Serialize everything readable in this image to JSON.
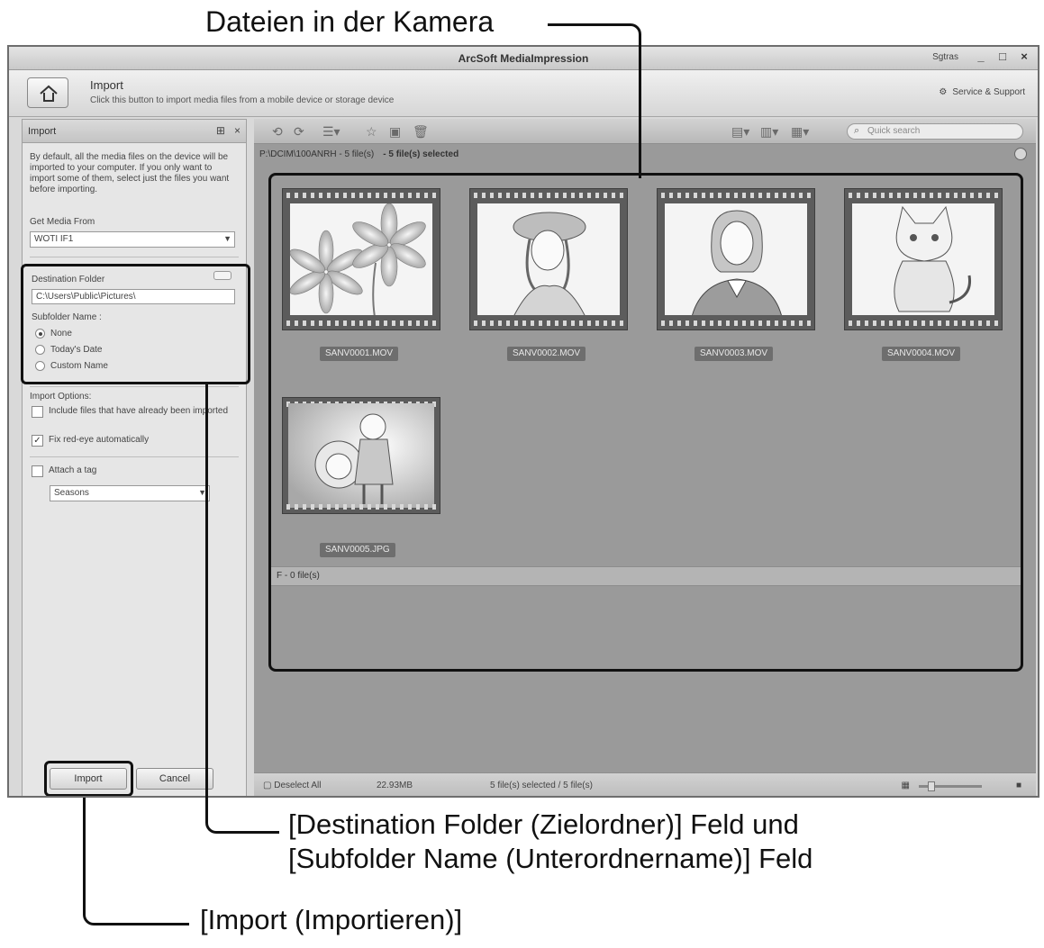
{
  "callouts": {
    "camera_files": "Dateien in der Kamera",
    "folder_fields_line1": "[Destination Folder (Zielordner)] Feld und",
    "folder_fields_line2": "[Subfolder Name (Unterordnername)] Feld",
    "import_button": "[Import (Importieren)]"
  },
  "window": {
    "title": "ArcSoft MediaImpression",
    "user": "Sgtras",
    "controls": [
      "_",
      "□",
      "×"
    ]
  },
  "header": {
    "title": "Import",
    "subtitle": "Click this button to import media files from a mobile device or storage device",
    "support": "Service & Support"
  },
  "import_panel": {
    "title": "Import",
    "description": "By default, all the media files on the device will be imported to your computer. If you only want to import some of them, select just the files you want before importing.",
    "get_media_label": "Get Media From",
    "get_media_value": "WOTI IF1",
    "destination_label": "Destination Folder",
    "destination_value": "C:\\Users\\Public\\Pictures\\",
    "subfolder_label": "Subfolder Name :",
    "subfolder_options": [
      {
        "label": "None",
        "selected": true
      },
      {
        "label": "Today's Date",
        "selected": false
      },
      {
        "label": "Custom Name",
        "selected": false
      }
    ],
    "import_options_label": "Import Options:",
    "options": [
      {
        "label": "Include files that have already been imported",
        "checked": false
      },
      {
        "label": "Fix red-eye automatically",
        "checked": true
      }
    ],
    "attach_tag_label": "Attach a tag",
    "attach_tag_checked": false,
    "tag_value": "Seasons",
    "import_button": "Import",
    "cancel_button": "Cancel"
  },
  "content": {
    "search_placeholder": "Quick search",
    "breadcrumb": "P:\\DCIM\\100ANRH - 5 file(s)",
    "selected_summary": "- 5 file(s) selected",
    "files": [
      "SANV0001.MOV",
      "SANV0002.MOV",
      "SANV0003.MOV",
      "SANV0004.MOV",
      "SANV0005.JPG"
    ],
    "group_label": "F - 0 file(s)",
    "status": {
      "deselect_all": "Deselect All",
      "size": "22.93MB",
      "selection": "5 file(s) selected / 5 file(s)"
    }
  }
}
